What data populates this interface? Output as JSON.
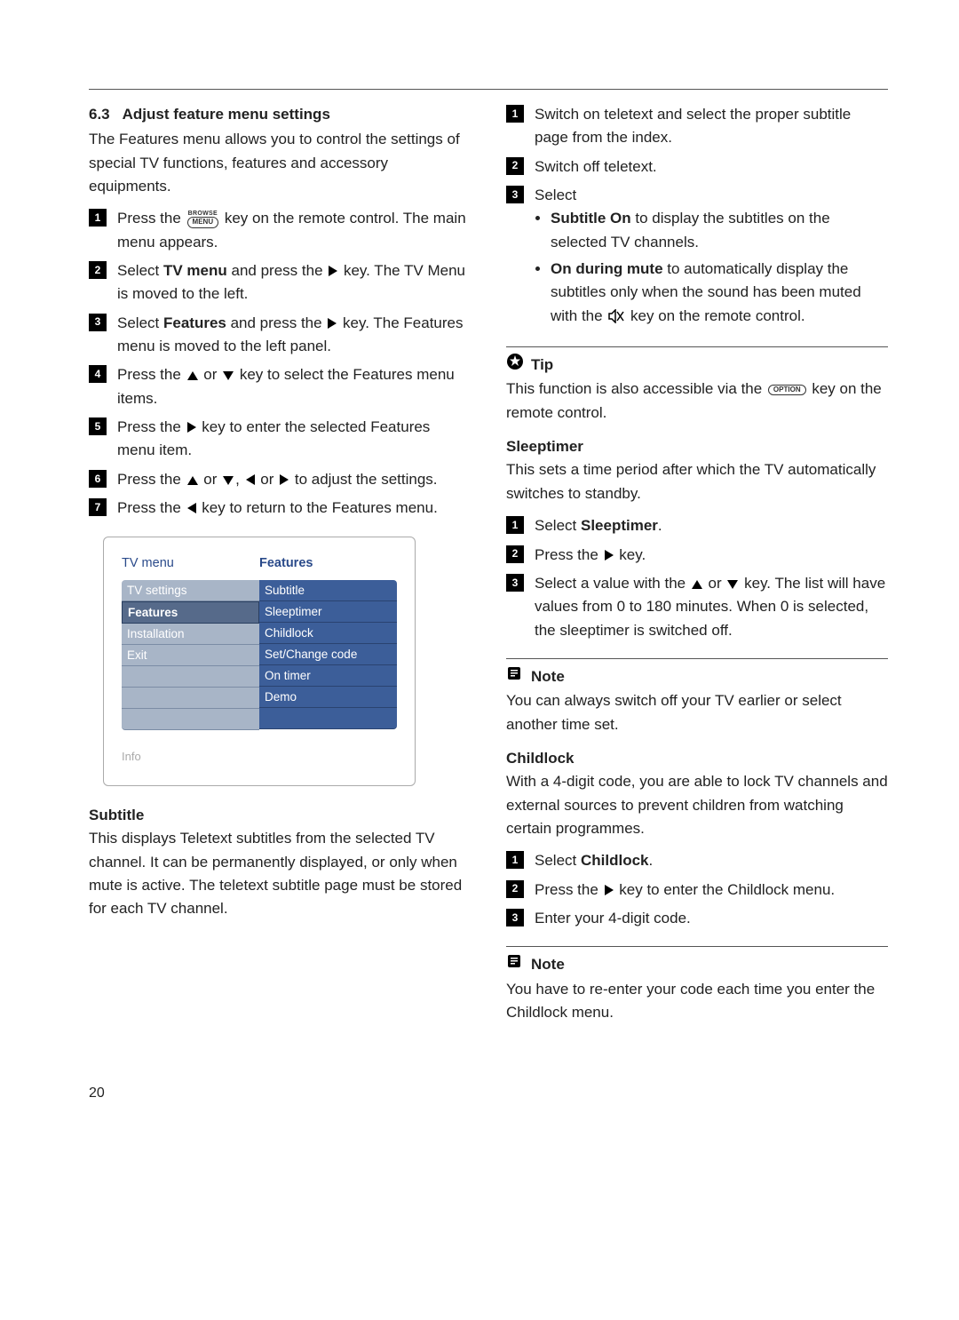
{
  "heading": {
    "number": "6.3",
    "title": "Adjust feature menu settings"
  },
  "intro": "The Features menu allows you to control the settings of special TV functions, features and accessory equipments.",
  "steps_main": {
    "s1a": "Press the ",
    "browse_tiny": "BROWSE",
    "browse_pill": "MENU",
    "s1b": " key on the remote control. The main menu appears.",
    "s2a": "Select ",
    "s2_bold": "TV menu",
    "s2b": " and press the ",
    "s2c": " key. The TV Menu is moved to the left.",
    "s3a": "Select ",
    "s3_bold": "Features",
    "s3b": " and press the ",
    "s3c": " key. The Features menu is moved to the left panel.",
    "s4a": "Press the ",
    "s4b": " or ",
    "s4c": " key to select the Features menu items.",
    "s5a": "Press the ",
    "s5b": " key to enter the selected Features menu item.",
    "s6a": "Press the ",
    "s6b": " or ",
    "s6c": ", ",
    "s6d": " or ",
    "s6e": " to adjust the settings.",
    "s7a": "Press the ",
    "s7b": " key to return to the Features menu."
  },
  "menu_diagram": {
    "hl": "TV menu",
    "hr": "Features",
    "left": [
      "TV settings",
      "Features",
      "Installation",
      "Exit",
      "",
      "",
      ""
    ],
    "right": [
      "Subtitle",
      "Sleeptimer",
      "Childlock",
      "Set/Change code",
      "On timer",
      "Demo",
      ""
    ],
    "info": "Info"
  },
  "subtitle": {
    "head": "Subtitle",
    "body": "This displays Teletext subtitles from the selected TV channel. It can be permanently displayed, or only when mute is active. The teletext subtitle page must be stored for each TV channel.",
    "s1": "Switch on teletext and select the proper subtitle page from the index.",
    "s2": "Switch off teletext.",
    "s3": "Select",
    "b1_bold": "Subtitle On",
    "b1_rest": " to display the subtitles on the selected TV channels.",
    "b2_bold": "On during mute",
    "b2_rest_a": " to automatically display the subtitles only when the sound has been muted with the ",
    "b2_rest_b": " key on the remote control."
  },
  "tip": {
    "label": "Tip",
    "body_a": "This function is also accessible via the ",
    "option_pill": "OPTION",
    "body_b": " key on the remote control."
  },
  "sleep": {
    "head": "Sleeptimer",
    "body": "This sets a time period after which the TV automatically switches to standby.",
    "s1a": "Select ",
    "s1_bold": "Sleeptimer",
    "s1b": ".",
    "s2a": "Press the ",
    "s2b": " key.",
    "s3a": "Select a value with the ",
    "s3b": " or ",
    "s3c": " key. The list will have values from 0 to 180 minutes. When 0 is selected, the sleeptimer is switched off."
  },
  "note1": {
    "label": "Note",
    "body": "You can always switch off your TV earlier or select another time set."
  },
  "child": {
    "head": "Childlock",
    "body": "With a 4-digit code, you are able to lock TV channels and external sources to prevent children from watching certain programmes.",
    "s1a": "Select ",
    "s1_bold": "Childlock",
    "s1b": ".",
    "s2a": "Press the ",
    "s2b": " key to enter the Childlock menu.",
    "s3": "Enter your 4-digit code."
  },
  "note2": {
    "label": "Note",
    "body": "You have to re-enter your code each time you enter the Childlock menu."
  },
  "page_number": "20"
}
